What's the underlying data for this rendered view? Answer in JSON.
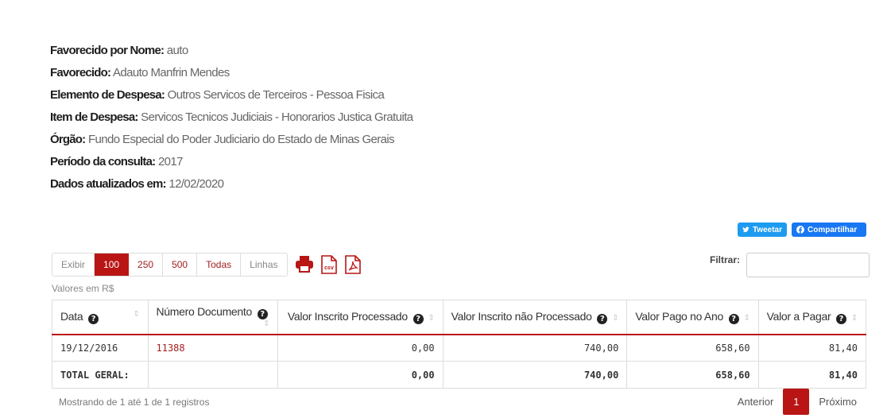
{
  "info": [
    {
      "label": "Favorecido por Nome:",
      "value": "auto"
    },
    {
      "label": "Favorecido:",
      "value": "Adauto Manfrin Mendes"
    },
    {
      "label": "Elemento de Despesa:",
      "value": "Outros Servicos de Terceiros - Pessoa Fisica"
    },
    {
      "label": "Item de Despesa:",
      "value": "Servicos Tecnicos Judiciais - Honorarios Justica Gratuita"
    },
    {
      "label": "Órgão:",
      "value": "Fundo Especial do Poder Judiciario do Estado de Minas Gerais"
    },
    {
      "label": "Período da consulta:",
      "value": "2017"
    },
    {
      "label": "Dados atualizados em:",
      "value": "12/02/2020"
    }
  ],
  "share": {
    "tweet": "Tweetar",
    "share": "Compartilhar"
  },
  "toolbar": {
    "show_label": "Exibir",
    "options": [
      "100",
      "250",
      "500",
      "Todas"
    ],
    "lines_label": "Linhas",
    "export_icons": [
      "print-icon",
      "csv-icon",
      "pdf-icon"
    ],
    "csv_text": "csv"
  },
  "filter": {
    "label": "Filtrar:",
    "value": ""
  },
  "currency_note": "Valores em R$",
  "table": {
    "headers": [
      "Data",
      "Número Documento",
      "Valor Inscrito Processado",
      "Valor Inscrito não Processado",
      "Valor Pago no Ano",
      "Valor a Pagar"
    ],
    "rows": [
      [
        "19/12/2016",
        "11388",
        "0,00",
        "740,00",
        "658,60",
        "81,40"
      ]
    ],
    "total": [
      "TOTAL GERAL:",
      "",
      "0,00",
      "740,00",
      "658,60",
      "81,40"
    ]
  },
  "footer": {
    "showing": "Mostrando de 1 até 1 de 1 registros"
  },
  "pager": {
    "prev": "Anterior",
    "current": "1",
    "next": "Próximo"
  },
  "colors": {
    "accent": "#b91515",
    "twitter": "#1d9bf0",
    "facebook": "#1877f2"
  }
}
